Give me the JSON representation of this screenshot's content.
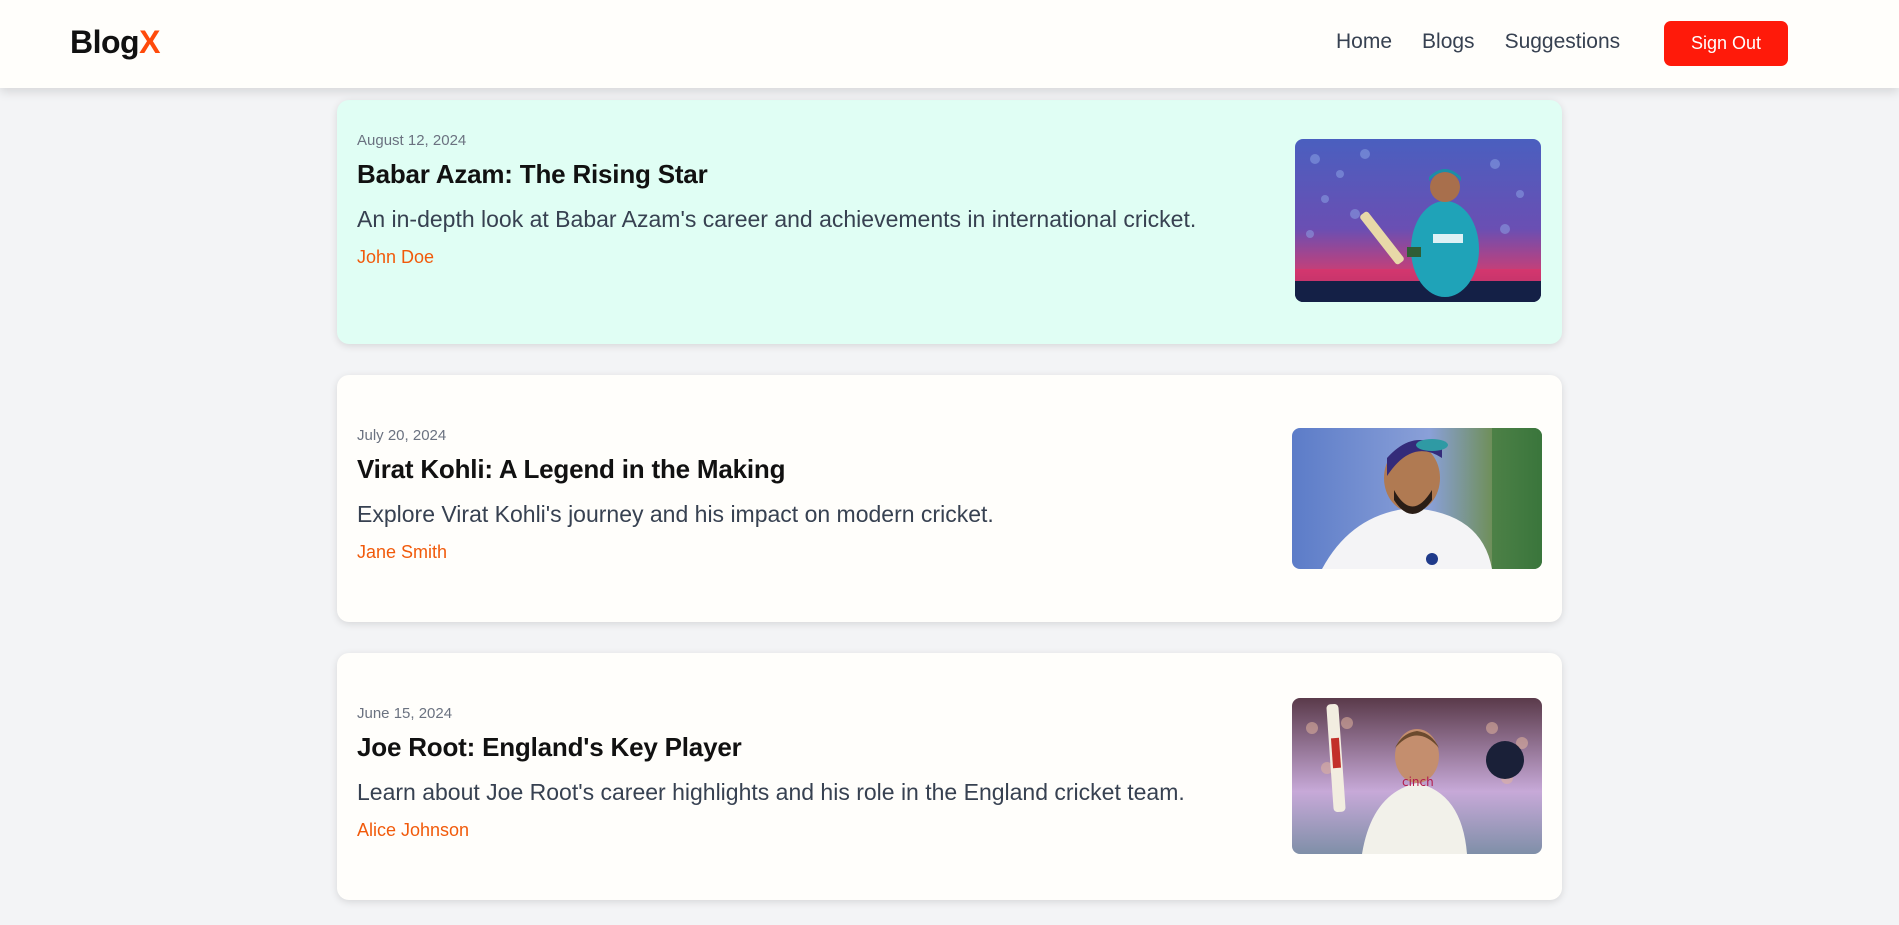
{
  "nav": {
    "logo_main": "Blog",
    "logo_accent": "X",
    "links": [
      {
        "label": "Home"
      },
      {
        "label": "Blogs"
      },
      {
        "label": "Suggestions"
      }
    ],
    "signout_label": "Sign Out"
  },
  "posts": [
    {
      "date": "August 12, 2024",
      "title": "Babar Azam: The Rising Star",
      "excerpt": "An in-depth look at Babar Azam's career and achievements in international cricket.",
      "author": "John Doe",
      "image": "cricketer-babar-azam-photo",
      "highlighted": true
    },
    {
      "date": "July 20, 2024",
      "title": "Virat Kohli: A Legend in the Making",
      "excerpt": "Explore Virat Kohli's journey and his impact on modern cricket.",
      "author": "Jane Smith",
      "image": "cricketer-virat-kohli-photo",
      "highlighted": false
    },
    {
      "date": "June 15, 2024",
      "title": "Joe Root: England's Key Player",
      "excerpt": "Learn about Joe Root's career highlights and his role in the England cricket team.",
      "author": "Alice Johnson",
      "image": "cricketer-joe-root-photo",
      "highlighted": false
    }
  ],
  "colors": {
    "accent": "#ff4a0a",
    "signout": "#ff1a0a",
    "author": "#f15a0b",
    "highlight_card": "#e0fef4"
  }
}
